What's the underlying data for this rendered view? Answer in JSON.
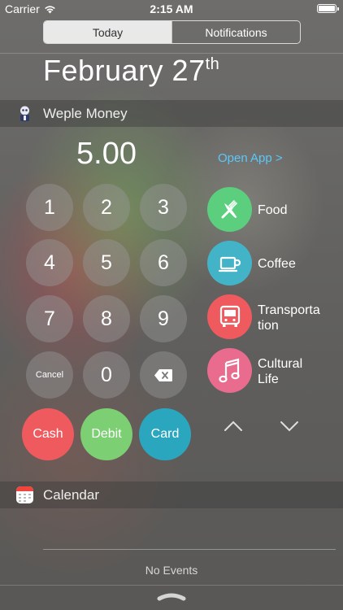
{
  "status_bar": {
    "carrier": "Carrier",
    "time": "2:15 AM",
    "battery_level": 1.0
  },
  "tabs": [
    {
      "label": "Today",
      "active": true
    },
    {
      "label": "Notifications",
      "active": false
    }
  ],
  "date": {
    "main": "February 27",
    "suffix": "th"
  },
  "weple": {
    "title": "Weple Money",
    "amount": "5.00",
    "open_app": "Open App >",
    "keys": [
      "1",
      "2",
      "3",
      "4",
      "5",
      "6",
      "7",
      "8",
      "9",
      "Cancel",
      "0"
    ],
    "payment_buttons": [
      {
        "label": "Cash",
        "color": "#ef5a5f"
      },
      {
        "label": "Debit",
        "color": "#7ccf73"
      },
      {
        "label": "Card",
        "color": "#2aa7bf"
      }
    ],
    "categories": [
      {
        "label": "Food",
        "icon": "fork-knife-icon",
        "color": "#5ccf7f"
      },
      {
        "label": "Coffee",
        "icon": "coffee-cup-icon",
        "color": "#43b4c7"
      },
      {
        "label": "Transporta\ntion",
        "icon": "bus-icon",
        "color": "#ef5a5f"
      },
      {
        "label": "Cultural\nLife",
        "icon": "music-note-icon",
        "color": "#e96b8e"
      }
    ]
  },
  "calendar": {
    "title": "Calendar",
    "empty_text": "No Events"
  }
}
